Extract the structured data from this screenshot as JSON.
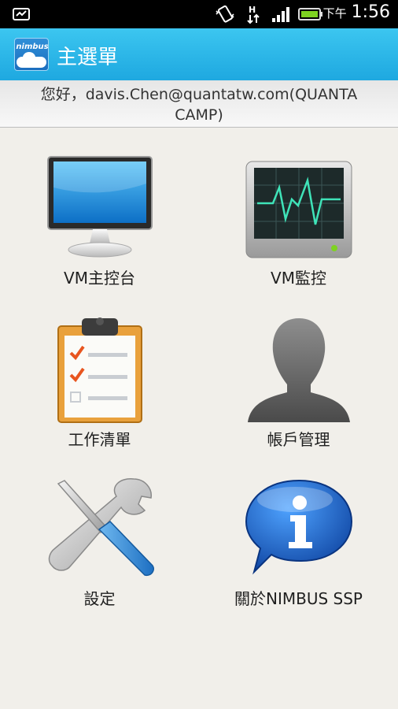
{
  "status_bar": {
    "time": "1:56",
    "ampm": "下午",
    "icons": [
      "sd-card-icon",
      "vibrate-icon",
      "data-transfer-icon",
      "signal-icon",
      "battery-icon"
    ]
  },
  "action_bar": {
    "logo_text": "nimbus",
    "title": "主選單"
  },
  "greeting": "您好，davis.Chen@quantatw.com(QUANTA CAMP)",
  "menu": [
    {
      "label": "VM主控台",
      "icon": "monitor-icon"
    },
    {
      "label": "VM監控",
      "icon": "heartbeat-monitor-icon"
    },
    {
      "label": "工作清單",
      "icon": "clipboard-checklist-icon"
    },
    {
      "label": "帳戶管理",
      "icon": "user-silhouette-icon"
    },
    {
      "label": "設定",
      "icon": "wrench-screwdriver-icon"
    },
    {
      "label": "關於NIMBUS SSP",
      "icon": "info-bubble-icon"
    }
  ],
  "colors": {
    "action_bar": "#1ea8e0",
    "background": "#f1efea",
    "status_bar": "#000000",
    "battery": "#7ed321",
    "checkmark": "#e8551f"
  }
}
